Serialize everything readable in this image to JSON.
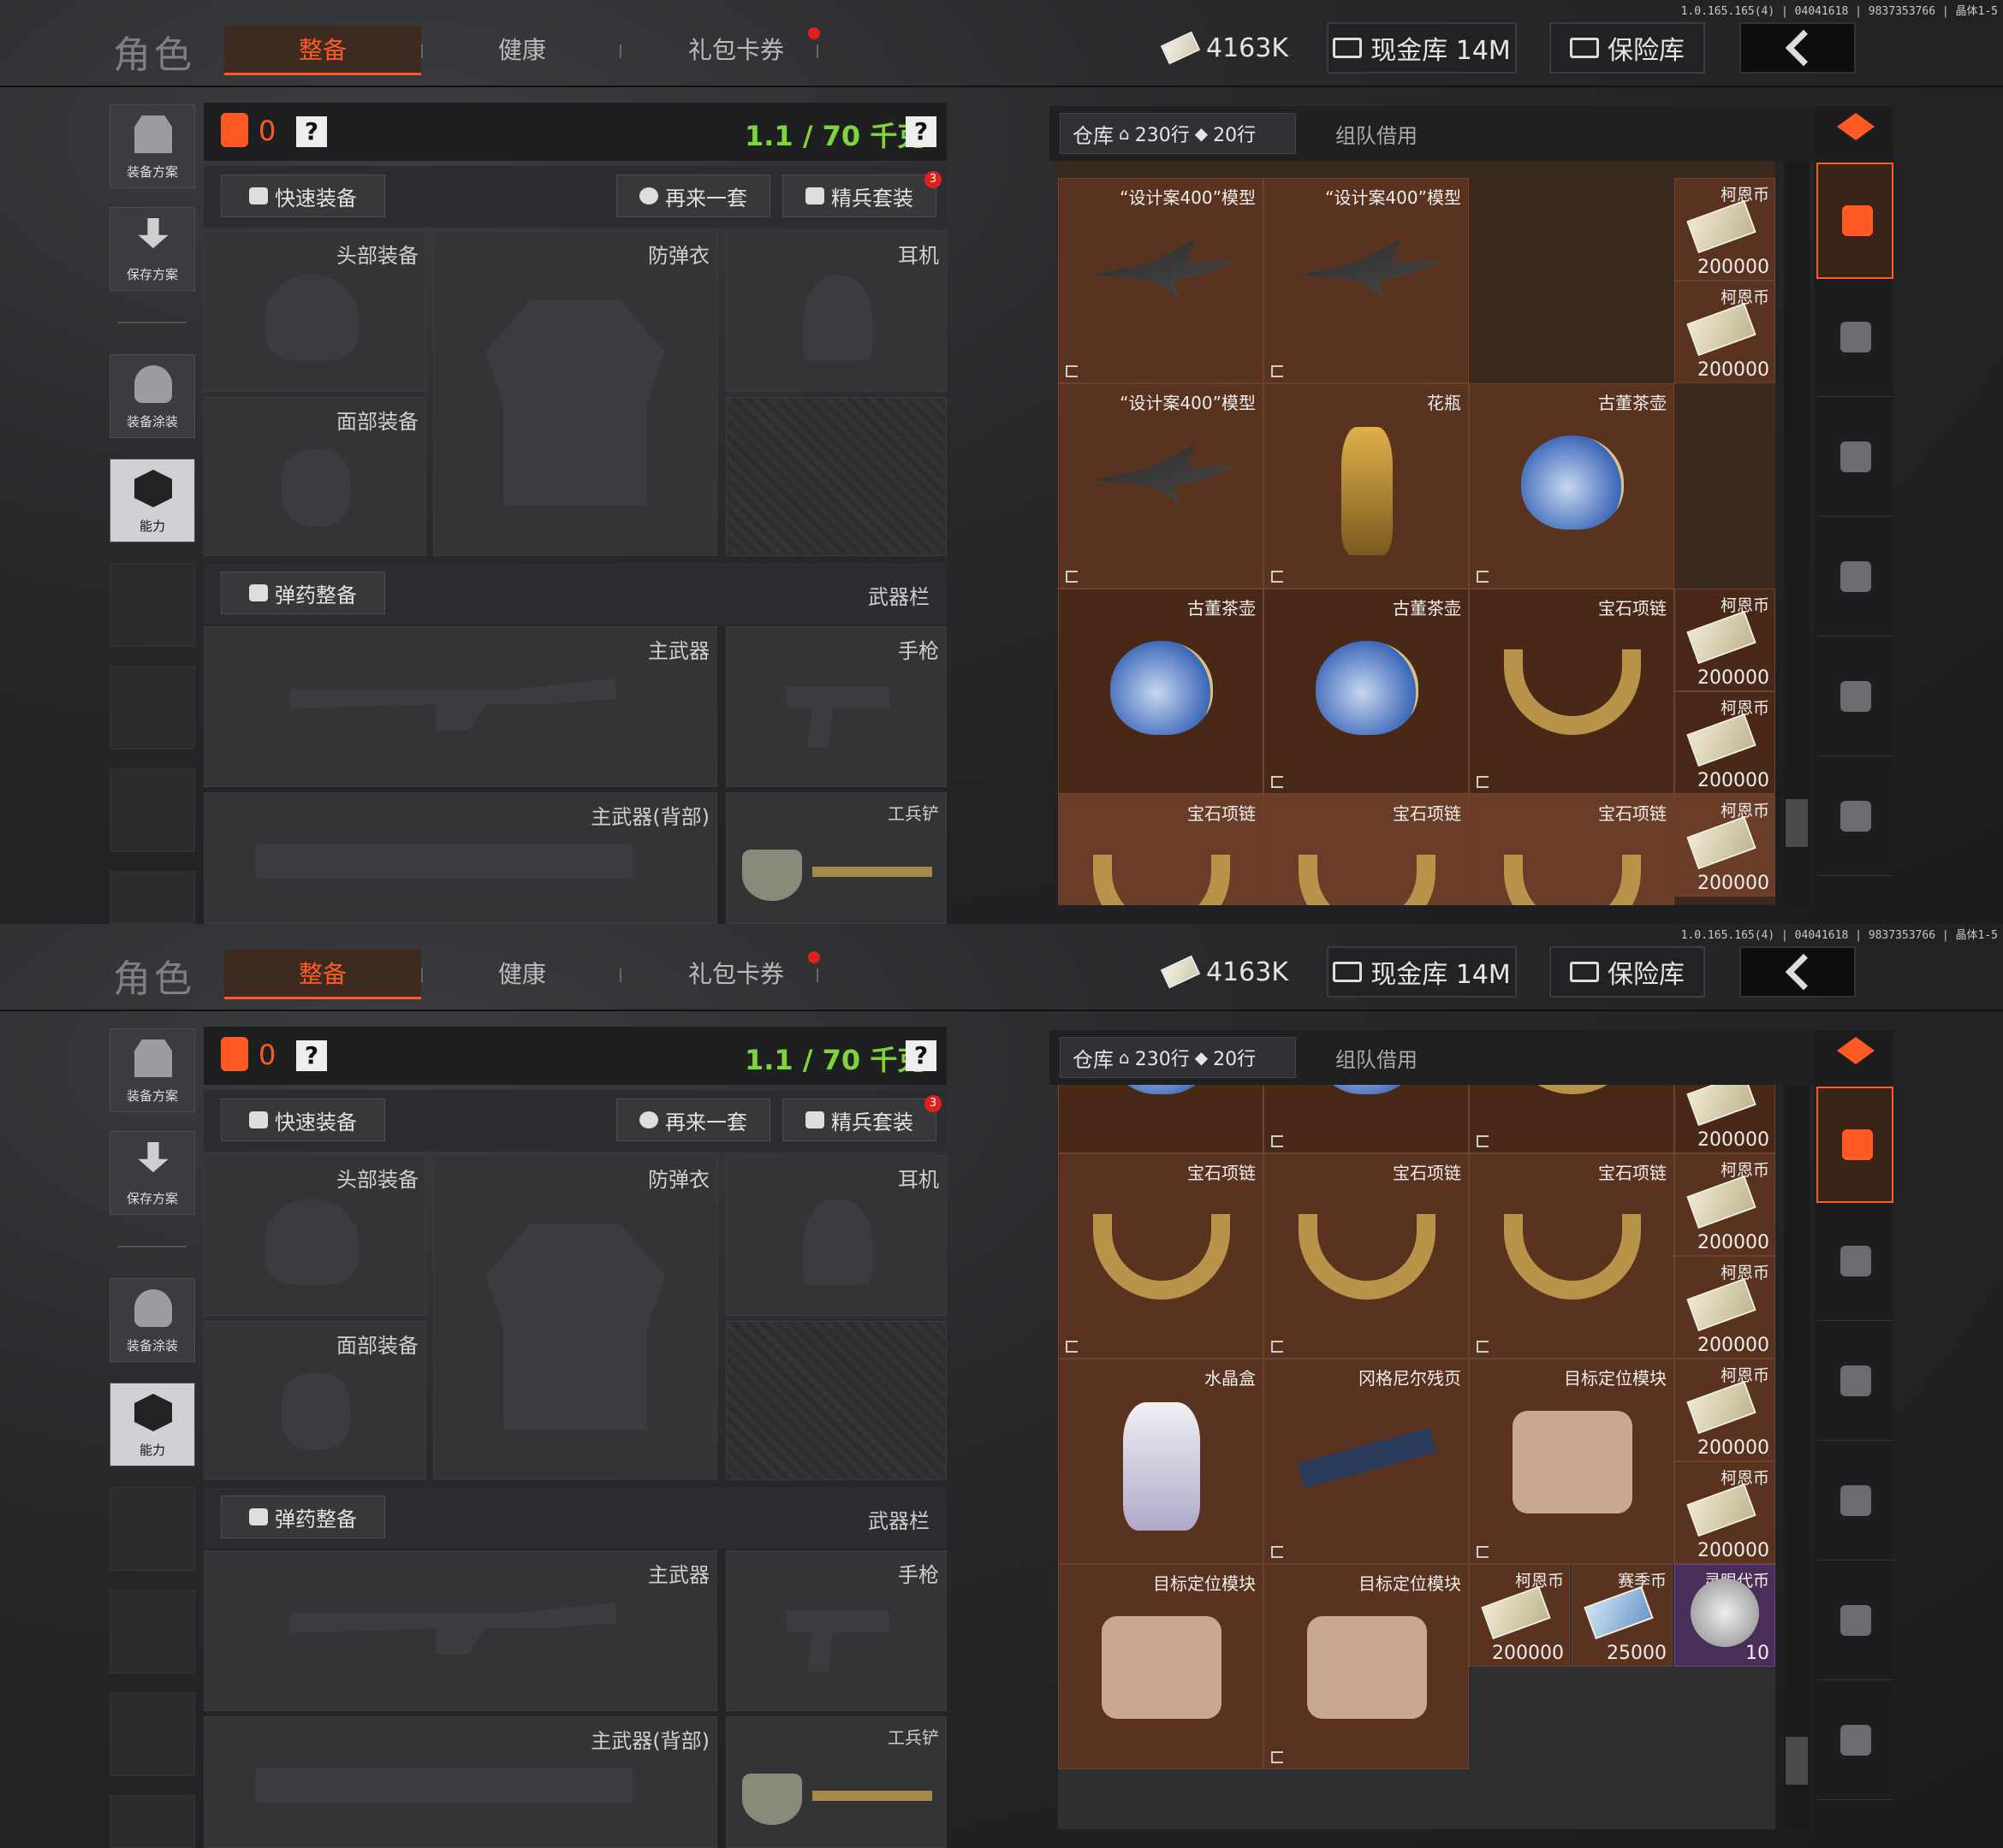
{
  "build": "1.0.165.165(4) | 04041618 | 9837353766 | 晶体1-5",
  "brand": "角色",
  "tabs": [
    "整备",
    "健康",
    "礼包卡券"
  ],
  "currency": "4163K",
  "cashvault": "现金库 14M",
  "safe": "保险库",
  "left_nav": [
    "装备方案",
    "保存方案",
    "装备涂装",
    "能力"
  ],
  "armor_count": "0",
  "help": "?",
  "weight": "1.1 / 70 千克",
  "quick_equip": "快速装备",
  "again": "再来一套",
  "elite": "精兵套装",
  "elite_badge": "3",
  "slots": {
    "head": "头部装备",
    "vest": "防弹衣",
    "ear": "耳机",
    "face": "面部装备",
    "ammo": "弹药整备",
    "weapon_bar": "武器栏",
    "primary": "主武器",
    "pistol": "手枪",
    "primary_back": "主武器(背部)",
    "shovel": "工兵铲"
  },
  "warehouse": {
    "label": "仓库",
    "rows": "230行",
    "rows2": "20行",
    "team": "组队借用"
  },
  "shot1_items": [
    {
      "label": "“设计案400”模型",
      "kind": "plane"
    },
    {
      "label": "“设计案400”模型",
      "kind": "plane"
    },
    {
      "label": "“设计案400”模型",
      "kind": "plane"
    },
    {
      "label": "花瓶",
      "kind": "vase"
    },
    {
      "label": "古董茶壶",
      "kind": "pot"
    },
    {
      "label": "古董茶壶",
      "kind": "pot"
    },
    {
      "label": "古董茶壶",
      "kind": "pot"
    },
    {
      "label": "宝石项链",
      "kind": "necklace"
    },
    {
      "label": "宝石项链",
      "kind": "necklace"
    },
    {
      "label": "宝石项链",
      "kind": "necklace"
    },
    {
      "label": "宝石项链",
      "kind": "necklace"
    }
  ],
  "coin": {
    "label": "柯恩币",
    "value": "200000"
  },
  "shot2_items": [
    {
      "label": "宝石项链"
    },
    {
      "label": "宝石项链"
    },
    {
      "label": "宝石项链"
    },
    {
      "label": "水晶盒"
    },
    {
      "label": "冈格尼尔残页"
    },
    {
      "label": "目标定位模块"
    },
    {
      "label": "目标定位模块"
    },
    {
      "label": "目标定位模块"
    }
  ],
  "shot2_small": [
    {
      "label": "柯恩币",
      "value": "200000"
    },
    {
      "label": "赛季币",
      "value": "25000"
    },
    {
      "label": "灵眼代币",
      "value": "10"
    }
  ],
  "colors": {
    "accent": "#ff5a24",
    "weight": "#7fd43a",
    "item_bg": "#5a3220"
  }
}
